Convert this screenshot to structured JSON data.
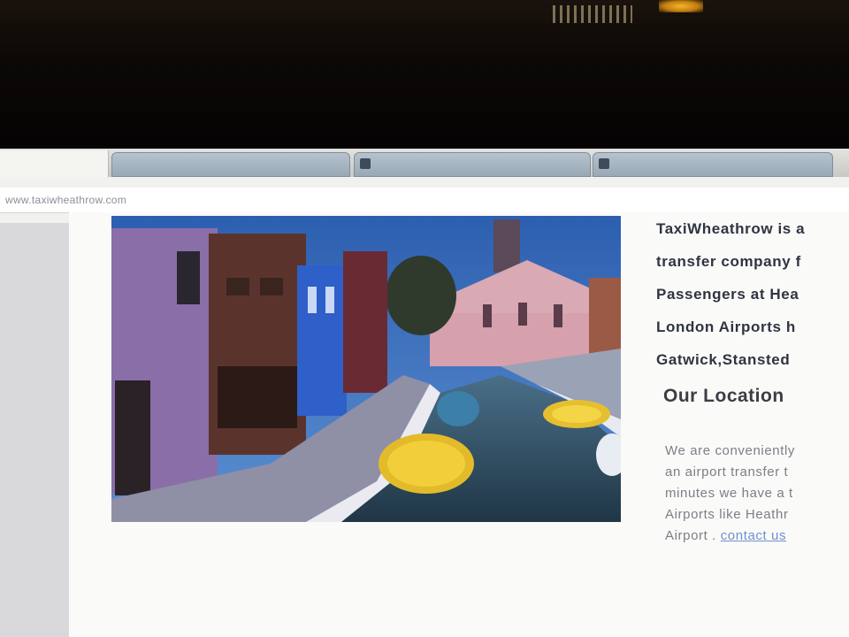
{
  "browser": {
    "url": "www.taxiwheathrow.com"
  },
  "intro": {
    "lines": [
      "TaxiWheathrow is a",
      "transfer company f",
      "Passengers at Hea",
      "London Airports h",
      "Gatwick,Stansted"
    ]
  },
  "location": {
    "heading": "Our Location",
    "lines": [
      "We are conveniently",
      "an airport transfer t",
      "minutes we have a t",
      "Airports like Heathr",
      "Airport ."
    ],
    "link_label": "contact us"
  }
}
